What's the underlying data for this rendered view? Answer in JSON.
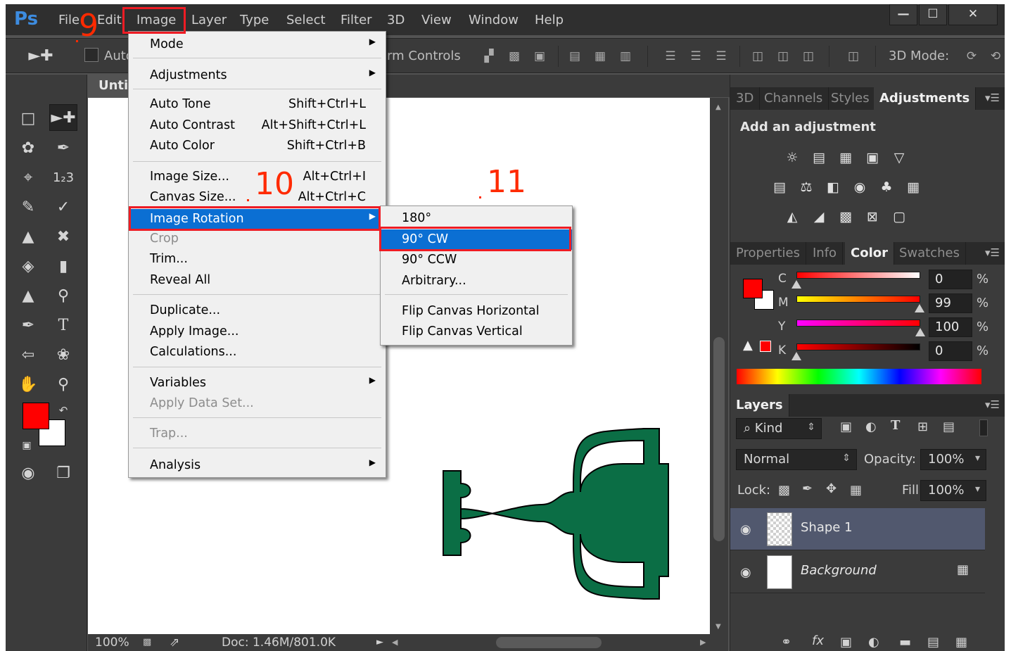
{
  "app": {
    "logo": "Ps",
    "menus": [
      "File",
      "Edit",
      "Image",
      "Layer",
      "Type",
      "Select",
      "Filter",
      "3D",
      "View",
      "Window",
      "Help"
    ],
    "window_controls": [
      "—",
      "☐",
      "✕"
    ]
  },
  "options_bar": {
    "auto_select_label": "Auto",
    "transform_controls_label": "rm Controls",
    "mode_3d_label": "3D Mode:"
  },
  "document": {
    "tab_title": "Unti",
    "zoom": "100%",
    "doc_info": "Doc: 1.46M/801.0K"
  },
  "image_menu": {
    "items": [
      {
        "label": "Mode",
        "shortcut": "",
        "submenu": true
      },
      {
        "label": "Adjustments",
        "shortcut": "",
        "submenu": true
      },
      {
        "label": "Auto Tone",
        "shortcut": "Shift+Ctrl+L"
      },
      {
        "label": "Auto Contrast",
        "shortcut": "Alt+Shift+Ctrl+L"
      },
      {
        "label": "Auto Color",
        "shortcut": "Shift+Ctrl+B"
      },
      {
        "label": "Image Size...",
        "shortcut": "Alt+Ctrl+I"
      },
      {
        "label": "Canvas Size...",
        "shortcut": "Alt+Ctrl+C"
      },
      {
        "label": "Image Rotation",
        "shortcut": "",
        "submenu": true,
        "highlighted": true
      },
      {
        "label": "Crop",
        "shortcut": "",
        "disabled": true
      },
      {
        "label": "Trim...",
        "shortcut": ""
      },
      {
        "label": "Reveal All",
        "shortcut": ""
      },
      {
        "label": "Duplicate...",
        "shortcut": ""
      },
      {
        "label": "Apply Image...",
        "shortcut": ""
      },
      {
        "label": "Calculations...",
        "shortcut": ""
      },
      {
        "label": "Variables",
        "shortcut": "",
        "submenu": true
      },
      {
        "label": "Apply Data Set...",
        "shortcut": "",
        "disabled": true
      },
      {
        "label": "Trap...",
        "shortcut": "",
        "disabled": true
      },
      {
        "label": "Analysis",
        "shortcut": "",
        "submenu": true
      }
    ]
  },
  "rotation_submenu": {
    "items": [
      {
        "label": "180°"
      },
      {
        "label": "90° CW",
        "highlighted": true
      },
      {
        "label": "90° CCW"
      },
      {
        "label": "Arbitrary..."
      },
      {
        "label": "Flip Canvas Horizontal"
      },
      {
        "label": "Flip Canvas Vertical"
      }
    ]
  },
  "annotations": {
    "step_9": "9",
    "step_10": "10",
    "step_11": "11",
    "color": "#ff2a00"
  },
  "adjustments_panel": {
    "tabs": [
      "3D",
      "Channels",
      "Styles",
      "Adjustments"
    ],
    "active_tab": "Adjustments",
    "title": "Add an adjustment"
  },
  "color_panel": {
    "tabs": [
      "Properties",
      "Info",
      "Color",
      "Swatches"
    ],
    "active_tab": "Color",
    "foreground": "#ff0000",
    "background": "#ffffff",
    "channels": [
      {
        "label": "C",
        "value": "0",
        "unit": "%"
      },
      {
        "label": "M",
        "value": "99",
        "unit": "%"
      },
      {
        "label": "Y",
        "value": "100",
        "unit": "%"
      },
      {
        "label": "K",
        "value": "0",
        "unit": "%"
      }
    ]
  },
  "layers_panel": {
    "tab": "Layers",
    "filter_label": "⌕ Kind",
    "blend_mode": "Normal",
    "opacity_label": "Opacity:",
    "opacity_value": "100%",
    "lock_label": "Lock:",
    "fill_label": "Fill:",
    "fill_value": "100%",
    "layers": [
      {
        "name": "Shape 1",
        "selected": true
      },
      {
        "name": "Background",
        "locked": true
      }
    ]
  },
  "shape_color": "#0b6e45"
}
